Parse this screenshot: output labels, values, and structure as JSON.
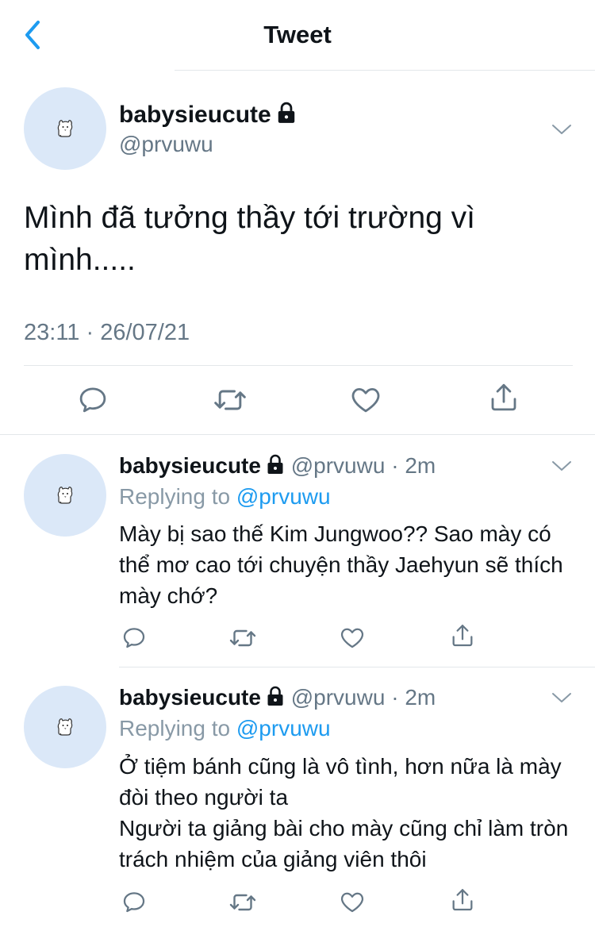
{
  "header": {
    "title": "Tweet"
  },
  "main_tweet": {
    "display_name": "babysieucute",
    "handle": "@prvuwu",
    "text": "Mình đã tưởng thầy tới trường vì mình.....",
    "timestamp": "23:11 · 26/07/21"
  },
  "replies": [
    {
      "display_name": "babysieucute",
      "handle": "@prvuwu",
      "dot": "·",
      "time": "2m",
      "replying_prefix": "Replying to",
      "replying_to": "@prvuwu",
      "text": "Mày bị sao thế Kim Jungwoo?? Sao mày có thể mơ cao tới chuyện thầy Jaehyun sẽ thích mày chớ?"
    },
    {
      "display_name": "babysieucute",
      "handle": "@prvuwu",
      "dot": "·",
      "time": "2m",
      "replying_prefix": "Replying to",
      "replying_to": "@prvuwu",
      "text_line1": "Ở tiệm bánh cũng là vô tình, hơn nữa là mày đòi theo người ta",
      "text_line2": "Người ta giảng bài cho mày cũng chỉ làm tròn trách nhiệm của giảng viên thôi"
    }
  ],
  "icons": {
    "back": "chevron-left-icon",
    "lock": "lock-icon",
    "more": "chevron-down-icon",
    "reply": "comment-icon",
    "retweet": "retweet-icon",
    "like": "heart-icon",
    "share": "share-icon",
    "avatar": "dog-sticker-icon"
  },
  "colors": {
    "accent": "#1d9bf0",
    "muted": "#657786",
    "avatar_bg": "#dbe8f8",
    "divider": "#e3e7ea"
  }
}
